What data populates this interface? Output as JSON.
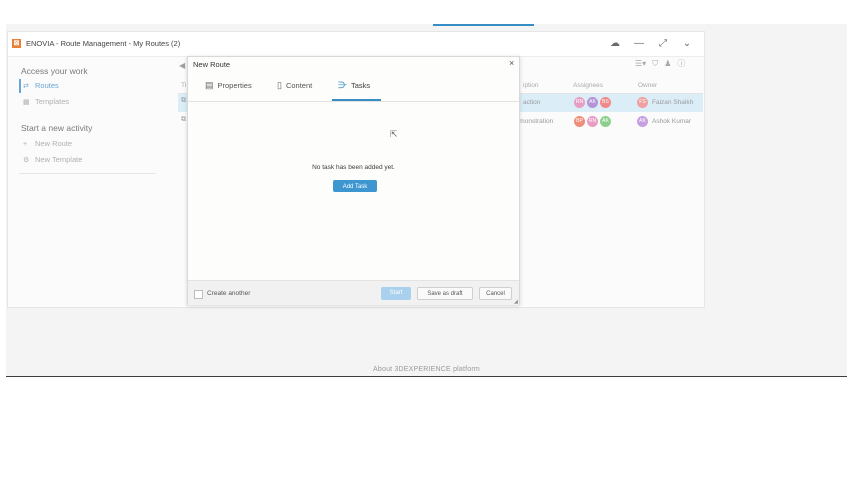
{
  "widget": {
    "title": "ENOVIA - Route Management - My Routes (2)",
    "logo_icon": "enovia-logo-icon",
    "header_icons": [
      "cloud-icon",
      "minimize-icon",
      "fullscreen-icon",
      "chevron-down-icon"
    ]
  },
  "sidebar": {
    "section1": "Access your work",
    "items1": [
      {
        "label": "Routes",
        "icon": "routes-icon",
        "active": true
      },
      {
        "label": "Templates",
        "icon": "grid-icon",
        "active": false
      }
    ],
    "section2": "Start a new activity",
    "items2": [
      {
        "label": "New Route",
        "icon": "plus-icon"
      },
      {
        "label": "New Template",
        "icon": "template-icon"
      }
    ]
  },
  "table": {
    "columns": [
      "Ti",
      "iption",
      "Assignees",
      "Owner"
    ],
    "rows": [
      {
        "description": "action",
        "assignees": [
          "RN",
          "AK",
          "BS"
        ],
        "owner": "Faizan Shaikh",
        "owner_initials": "FS",
        "selected": true
      },
      {
        "description": "Demonstration",
        "assignees": [
          "BP",
          "RN",
          "AK"
        ],
        "owner": "Ashok Kumar",
        "owner_initials": "AK",
        "selected": false
      }
    ]
  },
  "modal": {
    "title": "New Route",
    "tabs": [
      {
        "label": "Properties",
        "icon": "table-icon"
      },
      {
        "label": "Content",
        "icon": "document-icon"
      },
      {
        "label": "Tasks",
        "icon": "tasks-icon",
        "active": true
      }
    ],
    "empty_message": "No task has been added yet.",
    "add_task_label": "Add Task",
    "create_another_label": "Create another",
    "start_label": "Start",
    "save_draft_label": "Save as draft",
    "cancel_label": "Cancel"
  },
  "footer": {
    "text": "About 3DEXPERIENCE platform"
  },
  "colors": {
    "accent": "#368ec4",
    "button": "#3e96d1",
    "selected_row": "#dbeef8"
  }
}
